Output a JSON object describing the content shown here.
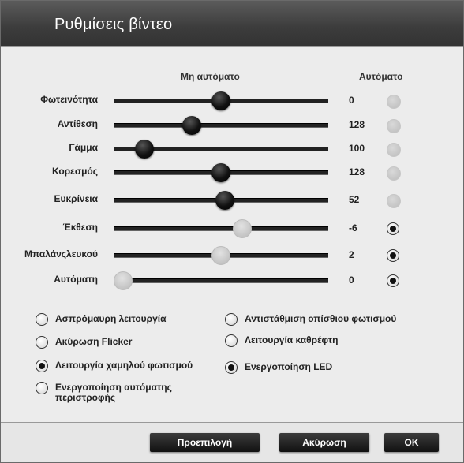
{
  "window": {
    "title": "Ρυθμίσεις βίντεο"
  },
  "headers": {
    "manual": "Μη αυτόματο",
    "auto": "Αυτόματο"
  },
  "sliders": [
    {
      "label": "Φωτεινότητα",
      "value": "0",
      "level": 0.5,
      "enabled": true,
      "auto": false
    },
    {
      "label": "Αντίθεση",
      "value": "128",
      "level": 0.35,
      "enabled": true,
      "auto": false
    },
    {
      "label": "Γάμμα",
      "value": "100",
      "level": 0.11,
      "enabled": true,
      "auto": false
    },
    {
      "label": "Κορεσμός",
      "value": "128",
      "level": 0.5,
      "enabled": true,
      "auto": false
    },
    {
      "label": "Ευκρίνεια",
      "value": "52",
      "level": 0.52,
      "enabled": true,
      "auto": false
    },
    {
      "label": "Έκθεση",
      "value": "-6",
      "level": 0.61,
      "enabled": false,
      "auto": true
    },
    {
      "label": "Μπαλάνςλευκού",
      "value": "2",
      "level": 0.5,
      "enabled": false,
      "auto": true
    },
    {
      "label": "Αυτόματη",
      "value": "0",
      "level": 0.0,
      "enabled": false,
      "auto": true
    }
  ],
  "options_left": [
    {
      "label": "Ασπρόμαυρη λειτουργία",
      "checked": false
    },
    {
      "label": "Ακύρωση Flicker",
      "checked": false
    },
    {
      "label": "Λειτουργία χαμηλού φωτισμού",
      "checked": true
    },
    {
      "label": "Ενεργοποίηση αυτόματης περιστροφής",
      "checked": false
    }
  ],
  "options_right": [
    {
      "label": "Αντιστάθμιση οπίσθιου φωτισμού",
      "checked": false
    },
    {
      "label": "Λειτουργία καθρέφτη",
      "checked": false
    },
    {
      "label": "Ενεργοποίηση LED",
      "checked": true
    }
  ],
  "buttons": {
    "defaults": "Προεπιλογή",
    "cancel": "Ακύρωση",
    "ok": "OK"
  }
}
